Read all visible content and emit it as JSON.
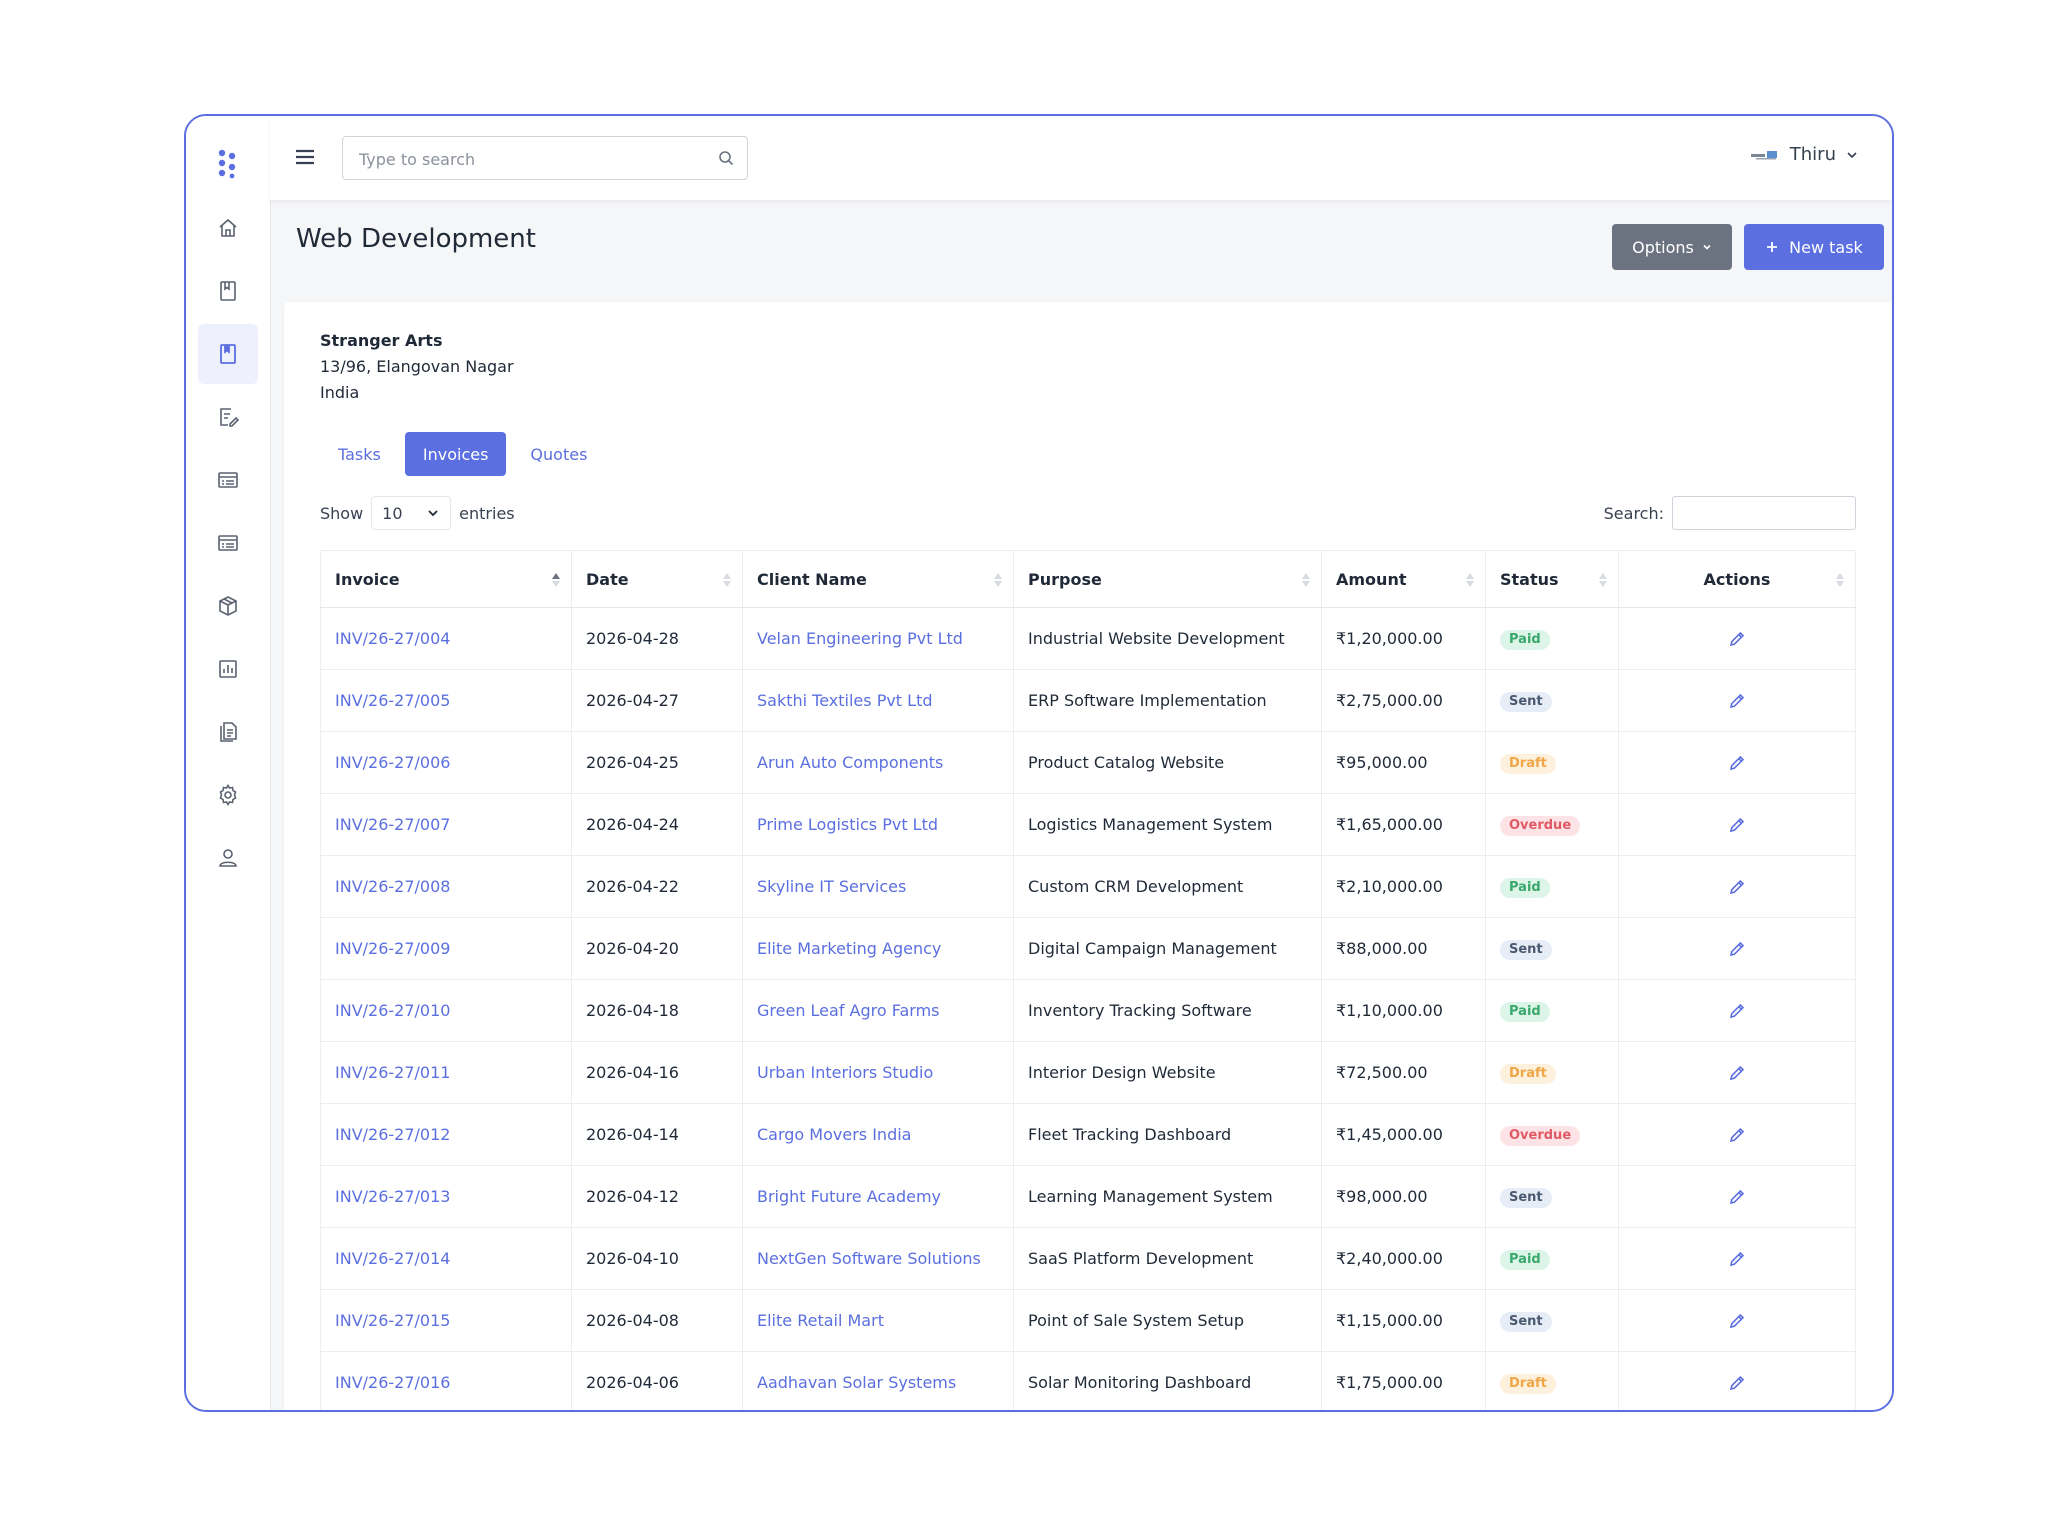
{
  "colors": {
    "accent": "#5b6fe0",
    "options_button": "#6b7280",
    "paid_bg": "#dcf5e8",
    "paid_fg": "#3aa86b",
    "sent_bg": "#e6edf6",
    "sent_fg": "#4b5a70",
    "draft_bg": "#fdf0dc",
    "draft_fg": "#f0a646",
    "overdue_bg": "#fde3e5",
    "overdue_fg": "#e05a66"
  },
  "sidebar": {
    "logo_icon": "dots-logo-icon",
    "items": [
      {
        "icon": "home-icon",
        "active": false
      },
      {
        "icon": "book-icon",
        "active": false
      },
      {
        "icon": "bookmark-icon",
        "active": true
      },
      {
        "icon": "edit-doc-icon",
        "active": false
      },
      {
        "icon": "list-card-icon",
        "active": false
      },
      {
        "icon": "list-card-icon",
        "active": false
      },
      {
        "icon": "box-icon",
        "active": false
      },
      {
        "icon": "chart-icon",
        "active": false
      },
      {
        "icon": "document-icon",
        "active": false
      },
      {
        "icon": "gear-icon",
        "active": false
      },
      {
        "icon": "user-icon",
        "active": false
      }
    ]
  },
  "header": {
    "search_placeholder": "Type to search",
    "user_name": "Thiru"
  },
  "page": {
    "title": "Web Development",
    "options_label": "Options",
    "new_task_label": "New task"
  },
  "company": {
    "name": "Stranger Arts",
    "address": "13/96, Elangovan Nagar",
    "country": "India"
  },
  "tabs": [
    {
      "label": "Tasks",
      "active": false
    },
    {
      "label": "Invoices",
      "active": true
    },
    {
      "label": "Quotes",
      "active": false
    }
  ],
  "table_controls": {
    "show_label": "Show",
    "entries_value": "10",
    "entries_label": "entries",
    "search_label": "Search:"
  },
  "table": {
    "columns": [
      "Invoice",
      "Date",
      "Client Name",
      "Purpose",
      "Amount",
      "Status",
      "Actions"
    ],
    "rows": [
      {
        "invoice": "INV/26-27/004",
        "date": "2026-04-28",
        "client": "Velan Engineering Pvt Ltd",
        "purpose": "Industrial Website Development",
        "amount": "₹1,20,000.00",
        "status": "Paid"
      },
      {
        "invoice": "INV/26-27/005",
        "date": "2026-04-27",
        "client": "Sakthi Textiles Pvt Ltd",
        "purpose": "ERP Software Implementation",
        "amount": "₹2,75,000.00",
        "status": "Sent"
      },
      {
        "invoice": "INV/26-27/006",
        "date": "2026-04-25",
        "client": "Arun Auto Components",
        "purpose": "Product Catalog Website",
        "amount": "₹95,000.00",
        "status": "Draft"
      },
      {
        "invoice": "INV/26-27/007",
        "date": "2026-04-24",
        "client": "Prime Logistics Pvt Ltd",
        "purpose": "Logistics Management System",
        "amount": "₹1,65,000.00",
        "status": "Overdue"
      },
      {
        "invoice": "INV/26-27/008",
        "date": "2026-04-22",
        "client": "Skyline IT Services",
        "purpose": "Custom CRM Development",
        "amount": "₹2,10,000.00",
        "status": "Paid"
      },
      {
        "invoice": "INV/26-27/009",
        "date": "2026-04-20",
        "client": "Elite Marketing Agency",
        "purpose": "Digital Campaign Management",
        "amount": "₹88,000.00",
        "status": "Sent"
      },
      {
        "invoice": "INV/26-27/010",
        "date": "2026-04-18",
        "client": "Green Leaf Agro Farms",
        "purpose": "Inventory Tracking Software",
        "amount": "₹1,10,000.00",
        "status": "Paid"
      },
      {
        "invoice": "INV/26-27/011",
        "date": "2026-04-16",
        "client": "Urban Interiors Studio",
        "purpose": "Interior Design Website",
        "amount": "₹72,500.00",
        "status": "Draft"
      },
      {
        "invoice": "INV/26-27/012",
        "date": "2026-04-14",
        "client": "Cargo Movers India",
        "purpose": "Fleet Tracking Dashboard",
        "amount": "₹1,45,000.00",
        "status": "Overdue"
      },
      {
        "invoice": "INV/26-27/013",
        "date": "2026-04-12",
        "client": "Bright Future Academy",
        "purpose": "Learning Management System",
        "amount": "₹98,000.00",
        "status": "Sent"
      },
      {
        "invoice": "INV/26-27/014",
        "date": "2026-04-10",
        "client": "NextGen Software Solutions",
        "purpose": "SaaS Platform Development",
        "amount": "₹2,40,000.00",
        "status": "Paid"
      },
      {
        "invoice": "INV/26-27/015",
        "date": "2026-04-08",
        "client": "Elite Retail Mart",
        "purpose": "Point of Sale System Setup",
        "amount": "₹1,15,000.00",
        "status": "Sent"
      },
      {
        "invoice": "INV/26-27/016",
        "date": "2026-04-06",
        "client": "Aadhavan Solar Systems",
        "purpose": "Solar Monitoring Dashboard",
        "amount": "₹1,75,000.00",
        "status": "Draft"
      }
    ]
  }
}
